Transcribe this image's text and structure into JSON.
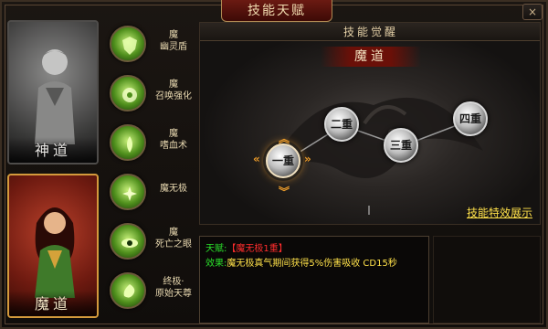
{
  "window": {
    "title": "技能天赋",
    "close_label": "×"
  },
  "paths": [
    {
      "label": "神道",
      "selected": false
    },
    {
      "label": "魔道",
      "selected": true
    }
  ],
  "skills": [
    {
      "line1": "魔",
      "line2": "幽灵盾",
      "icon": "ghost-shield-icon"
    },
    {
      "line1": "魔",
      "line2": "召唤强化",
      "icon": "summon-boost-icon"
    },
    {
      "line1": "魔",
      "line2": "嗜血术",
      "icon": "bloodthirst-icon"
    },
    {
      "line1": "",
      "line2": "魔无极",
      "icon": "infinite-icon"
    },
    {
      "line1": "魔",
      "line2": "死亡之眼",
      "icon": "death-eye-icon"
    },
    {
      "line1": "终极·",
      "line2": "原始天尊",
      "icon": "primal-lord-icon"
    }
  ],
  "awaken": {
    "header": "技能觉醒",
    "banner": "魔道",
    "nodes": [
      "一重",
      "二重",
      "三重",
      "四重"
    ],
    "active_node": "一重",
    "effect_link": "技能特效展示"
  },
  "info": {
    "talent_label": "天赋:",
    "talent_value": "【魔无极1重】",
    "effect_label": "效果:",
    "effect_value": "魔无极真气期间获得5%伤害吸收  CD15秒"
  },
  "colors": {
    "accent_red": "#6a1008",
    "gold_text": "#ffe14a",
    "green_label": "#2be02b",
    "red_value": "#ff2d2d"
  }
}
